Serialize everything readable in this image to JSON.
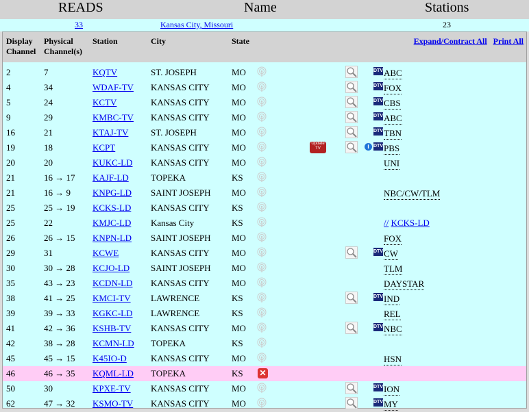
{
  "header": {
    "col1": "READS",
    "col2": "Name",
    "col3": "Stations"
  },
  "summary": {
    "count": "33",
    "location": "Kansas City, Missouri",
    "stations": "23"
  },
  "table": {
    "headers": {
      "display": "Display Channel",
      "display1": "Display",
      "display2": "Channel",
      "physical1": "Physical",
      "physical2": "Channel(s)",
      "station": "Station",
      "city": "City",
      "state": "State"
    },
    "expand_label": "Expand/Contract All",
    "print_label": "Print All",
    "update_label": "Update TV",
    "info_label": "i",
    "dtv_label": "DTV",
    "rows": [
      {
        "disp": "2",
        "phys": "7",
        "station": "KQTV",
        "city": "ST. JOSEPH",
        "state": "MO",
        "mag": true,
        "dtv": true,
        "net": "ABC"
      },
      {
        "disp": "4",
        "phys": "34",
        "station": "WDAF-TV",
        "city": "KANSAS CITY",
        "state": "MO",
        "mag": true,
        "dtv": true,
        "net": "FOX"
      },
      {
        "disp": "5",
        "phys": "24",
        "station": "KCTV",
        "city": "KANSAS CITY",
        "state": "MO",
        "mag": true,
        "dtv": true,
        "net": "CBS"
      },
      {
        "disp": "9",
        "phys": "29",
        "station": "KMBC-TV",
        "city": "KANSAS CITY",
        "state": "MO",
        "mag": true,
        "dtv": true,
        "net": "ABC"
      },
      {
        "disp": "16",
        "phys": "21",
        "station": "KTAJ-TV",
        "city": "ST. JOSEPH",
        "state": "MO",
        "mag": true,
        "dtv": true,
        "net": "TBN"
      },
      {
        "disp": "19",
        "phys": "18",
        "station": "KCPT",
        "city": "KANSAS CITY",
        "state": "MO",
        "mag": true,
        "dtv": true,
        "net": "PBS",
        "update": true,
        "info": true
      },
      {
        "disp": "20",
        "phys": "20",
        "station": "KUKC-LD",
        "city": "KANSAS CITY",
        "state": "MO",
        "net": "UNI"
      },
      {
        "disp": "21",
        "phys": "16 → 17",
        "station": "KAJF-LD",
        "city": "TOPEKA",
        "state": "KS",
        "net": ""
      },
      {
        "disp": "21",
        "phys": "16 → 9",
        "station": "KNPG-LD",
        "city": "SAINT JOSEPH",
        "state": "MO",
        "net": "NBC/CW/TLM"
      },
      {
        "disp": "25",
        "phys": "25 → 19",
        "station": "KCKS-LD",
        "city": "KANSAS CITY",
        "state": "KS",
        "net": ""
      },
      {
        "disp": "25",
        "phys": "22",
        "station": "KMJC-LD",
        "city": "Kansas City",
        "state": "KS",
        "net": "",
        "link_prefix": "//",
        "link": "KCKS-LD"
      },
      {
        "disp": "26",
        "phys": "26 → 15",
        "station": "KNPN-LD",
        "city": "SAINT JOSEPH",
        "state": "MO",
        "net": "FOX"
      },
      {
        "disp": "29",
        "phys": "31",
        "station": "KCWE",
        "city": "KANSAS CITY",
        "state": "MO",
        "mag": true,
        "dtv": true,
        "net": "CW"
      },
      {
        "disp": "30",
        "phys": "30 → 28",
        "station": "KCJO-LD",
        "city": "SAINT JOSEPH",
        "state": "MO",
        "net": "TLM"
      },
      {
        "disp": "35",
        "phys": "43 → 23",
        "station": "KCDN-LD",
        "city": "KANSAS CITY",
        "state": "MO",
        "net": "DAYSTAR"
      },
      {
        "disp": "38",
        "phys": "41 → 25",
        "station": "KMCI-TV",
        "city": "LAWRENCE",
        "state": "KS",
        "mag": true,
        "dtv": true,
        "net": "IND"
      },
      {
        "disp": "39",
        "phys": "39 → 33",
        "station": "KGKC-LD",
        "city": "LAWRENCE",
        "state": "KS",
        "net": "REL"
      },
      {
        "disp": "41",
        "phys": "42 → 36",
        "station": "KSHB-TV",
        "city": "KANSAS CITY",
        "state": "MO",
        "mag": true,
        "dtv": true,
        "net": "NBC"
      },
      {
        "disp": "42",
        "phys": "38 → 28",
        "station": "KCMN-LD",
        "city": "TOPEKA",
        "state": "KS",
        "net": ""
      },
      {
        "disp": "45",
        "phys": "45 → 15",
        "station": "K45IO-D",
        "city": "KANSAS CITY",
        "state": "MO",
        "net": "HSN"
      },
      {
        "disp": "46",
        "phys": "46 → 35",
        "station": "KQML-LD",
        "city": "TOPEKA",
        "state": "KS",
        "net": "",
        "pink": true,
        "redx": true
      },
      {
        "disp": "50",
        "phys": "30",
        "station": "KPXE-TV",
        "city": "KANSAS CITY",
        "state": "MO",
        "mag": true,
        "dtv": true,
        "net": "ION"
      },
      {
        "disp": "62",
        "phys": "47 → 32",
        "station": "KSMO-TV",
        "city": "KANSAS CITY",
        "state": "MO",
        "mag": true,
        "dtv": true,
        "net": "MY"
      }
    ]
  }
}
